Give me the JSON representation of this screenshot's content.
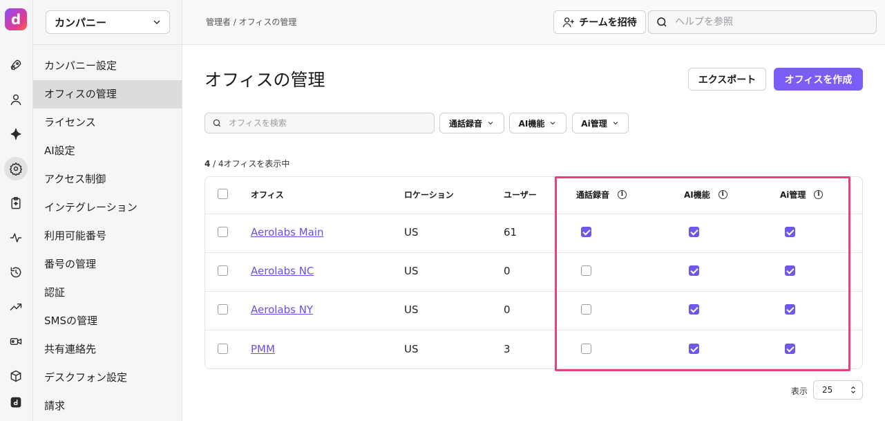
{
  "rail": {
    "logo": "d",
    "items": [
      "rocket-icon",
      "user-icon",
      "sparkle-icon",
      "gear-icon",
      "clipboard-icon",
      "activity-icon",
      "history-icon",
      "trending-icon",
      "video-icon",
      "box-icon",
      "dialpad-icon"
    ]
  },
  "sidebar": {
    "company_select": "カンパニー",
    "items": [
      {
        "label": "カンパニー設定"
      },
      {
        "label": "オフィスの管理",
        "active": true
      },
      {
        "label": "ライセンス"
      },
      {
        "label": "AI設定"
      },
      {
        "label": "アクセス制御"
      },
      {
        "label": "インテグレーション"
      },
      {
        "label": "利用可能番号"
      },
      {
        "label": "番号の管理"
      },
      {
        "label": "認証"
      },
      {
        "label": "SMSの管理"
      },
      {
        "label": "共有連絡先"
      },
      {
        "label": "デスクフォン設定"
      },
      {
        "label": "請求"
      }
    ]
  },
  "topbar": {
    "breadcrumb": "管理者 / オフィスの管理",
    "invite_label": "チームを招待",
    "help_placeholder": "ヘルプを参照"
  },
  "main": {
    "title": "オフィスの管理",
    "export_label": "エクスポート",
    "create_label": "オフィスを作成",
    "search_placeholder": "オフィスを検索",
    "filters": [
      "通話録音",
      "AI機能",
      "Ai管理"
    ],
    "count_bold": "4",
    "count_rest": " / 4オフィスを表示中",
    "accent_color": "#7b5cf5",
    "highlight_color": "#e8407f"
  },
  "table": {
    "headers": [
      "オフィス",
      "ロケーション",
      "ユーザー",
      "通話録音",
      "AI機能",
      "Ai管理"
    ],
    "rows": [
      {
        "office": "Aerolabs Main",
        "location": "US",
        "users": "61",
        "recording": true,
        "ai": true,
        "ai_admin": true
      },
      {
        "office": "Aerolabs NC",
        "location": "US",
        "users": "0",
        "recording": false,
        "ai": true,
        "ai_admin": true
      },
      {
        "office": "Aerolabs NY",
        "location": "US",
        "users": "0",
        "recording": false,
        "ai": true,
        "ai_admin": true
      },
      {
        "office": "PMM",
        "location": "US",
        "users": "3",
        "recording": false,
        "ai": true,
        "ai_admin": true
      }
    ]
  },
  "pagination": {
    "label": "表示",
    "page_size": "25"
  }
}
